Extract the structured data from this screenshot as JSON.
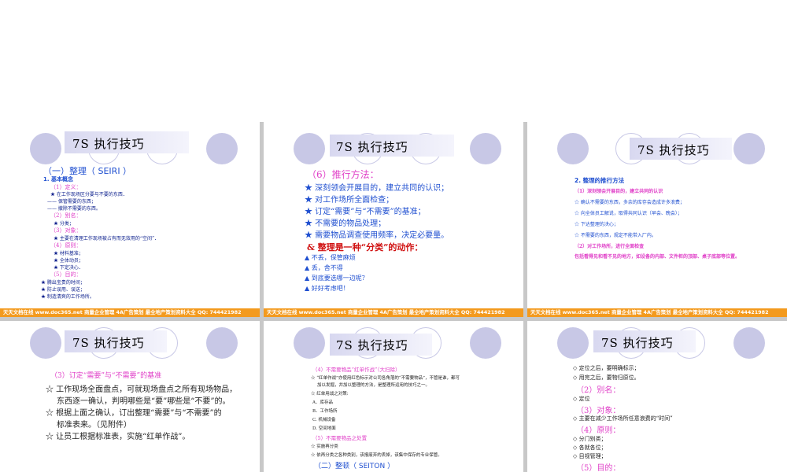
{
  "slides": {
    "s1": {
      "title": "7S 执行技巧",
      "heading": "（一）整理（ SEIRI ）",
      "sub1": "1. 基本概念",
      "lines": [
        "（1）定义：",
        "★ 在工作现场区分要与不要的东西．",
        "—— 保管需要的东西；",
        "—— 撤除不需要的东西。",
        "（2）别名：",
        "★ 分类；",
        "（3）对象：",
        "★ 主要在清理工作现场被占有而无效用的“空间”．",
        "（4）原则：",
        "★ 材料基准；",
        "★ 全体动员；",
        "★ 下定决心．",
        "（5）目的：",
        "★ 腾出宝贵的时间；",
        "★ 防止误用、误送；",
        "★ 制造清爽的工作场所。"
      ],
      "footer": "天天文档在线  www.doc365.net  商量企业管理 4A广告策划  最全地产策划资料大全  QQ: 744421982"
    },
    "s2": {
      "title": "7S 执行技巧",
      "heading": "（6）推行方法：",
      "items": [
        "★ 深刻领会开展目的，建立共同的认识；",
        "★ 对工作场所全面检查；",
        "★ 订定“需要”与“不需要”的基准；",
        "★ 不需要的物品处理；",
        "★ 需要物品调查使用频率，决定必要量。"
      ],
      "emphasis": "& 整理是一种“分类”的动作：",
      "actions": [
        "▲ 不丢，保管麻烦",
        "▲ 丢，舍不得",
        "▲ 到底要选哪一边呢？",
        "▲ 好好考虑吧！"
      ],
      "footer": "天天文档在线  www.doc365.net  商量企业管理 4A广告策划  最全地产策划资料大全  QQ: 744421982"
    },
    "s3": {
      "title": "7S 执行技巧",
      "heading": "2. 整理的推行方法",
      "lines": [
        "（1）深刻领会开展目的，建立共同的认识",
        "☆ 确认不需要的东西，多余的库存会造成许多浪费；",
        "☆ 向全体员工解说，取得共同认识（早会、晚会）；",
        "☆ 下达整理的决心；",
        "☆ 不需要的东西，规定不能带入厂内。",
        "（2）对工作场所，进行全面检查",
        "包括看得见和看不见的地方，如设备的内部、文件柜的顶部、桌子底部等位置。"
      ],
      "footer": "天天文档在线  www.doc365.net  商量企业管理 4A广告策划  最全地产策划资料大全  QQ: 744421982"
    },
    "s4": {
      "title": "7S 执行技巧",
      "heading": "（3）订定“需要”与“不需要”的基准",
      "lines": [
        "☆ 工作现场全面盘点，可就现场盘点之所有现场物品，",
        "东西逐一确认，判明哪些是“要”哪些是“不要”的。",
        "☆ 根据上面之确认，订出整理“需要”与“不需要”的",
        "标准表来。（见附件）",
        "☆ 让员工根据标准表，实施“红单作战”。"
      ]
    },
    "s5": {
      "title": "7S 执行技巧",
      "heading": "（4）不需要物品“红单作战”（大扫除）",
      "lines": [
        "☆ “红单作战”亦使用红色标示对公司各角落的“不需要物品”，不管是谁，都可",
        "加以发掘，并加以整理的方法，是整理所运用的技巧之一。",
        "☆ 红单用战之对策:",
        "A．库存品",
        "B．工作场所",
        "C. 机械设备",
        "D. 空间地面"
      ],
      "heading2": "（5）不需要物品之处置",
      "lines2": [
        "☆ 实施再分类",
        "☆ 依再分类之各种类别，该报废弃的丢掉，该集中保存的专业保管。"
      ],
      "heading3": "（二）整顿（ SEITON ）"
    },
    "s6": {
      "title": "7S 执行技巧",
      "lines": [
        "◇ 定位之后，要明确标示；",
        "◇ 用完之后，要物归原位。"
      ],
      "h2": "（2）别名：",
      "l2": "◇ 定位",
      "h3": "（3）对象：",
      "l3": "◇ 主要在减少工作场所任意浪费的“时间”",
      "h4": "（4）原则：",
      "l4": [
        "◇ 分门别类；",
        "◇ 各就各位；",
        "◇ 目视管理；"
      ],
      "h5": "（5）目的："
    }
  }
}
